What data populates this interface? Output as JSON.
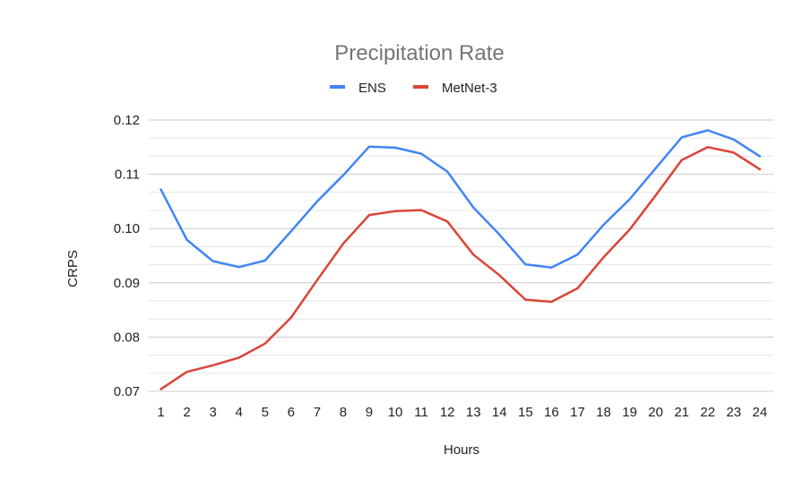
{
  "chart_data": {
    "type": "line",
    "title": "Precipitation Rate",
    "xlabel": "Hours",
    "ylabel": "CRPS",
    "x": [
      1,
      2,
      3,
      4,
      5,
      6,
      7,
      8,
      9,
      10,
      11,
      12,
      13,
      14,
      15,
      16,
      17,
      18,
      19,
      20,
      21,
      22,
      23,
      24
    ],
    "x_tick_labels": [
      "1",
      "2",
      "3",
      "4",
      "5",
      "6",
      "7",
      "8",
      "9",
      "10",
      "11",
      "12",
      "13",
      "14",
      "15",
      "16",
      "17",
      "18",
      "19",
      "20",
      "21",
      "22",
      "23",
      "24"
    ],
    "ylim": [
      0.07,
      0.12
    ],
    "y_ticks": [
      0.07,
      0.08,
      0.09,
      0.1,
      0.11,
      0.12
    ],
    "y_tick_labels": [
      "0.07",
      "0.08",
      "0.09",
      "0.10",
      "0.11",
      "0.12"
    ],
    "y_minor_per_major": 2,
    "grid": true,
    "legend_position": "top-center",
    "series": [
      {
        "name": "ENS",
        "color": "#4285F4",
        "values": [
          0.1072,
          0.0979,
          0.094,
          0.0929,
          0.0941,
          0.0995,
          0.105,
          0.1098,
          0.1151,
          0.1149,
          0.1138,
          0.1105,
          0.1039,
          0.0989,
          0.0934,
          0.0928,
          0.0952,
          0.1007,
          0.1054,
          0.1111,
          0.1168,
          0.1181,
          0.1164,
          0.1133
        ]
      },
      {
        "name": "MetNet-3",
        "color": "#DB4437",
        "values": [
          0.0704,
          0.0736,
          0.0748,
          0.0762,
          0.0788,
          0.0836,
          0.0905,
          0.0972,
          0.1025,
          0.1032,
          0.1034,
          0.1013,
          0.0952,
          0.0914,
          0.0869,
          0.0865,
          0.089,
          0.0947,
          0.0998,
          0.1061,
          0.1126,
          0.115,
          0.114,
          0.1109
        ]
      }
    ]
  }
}
